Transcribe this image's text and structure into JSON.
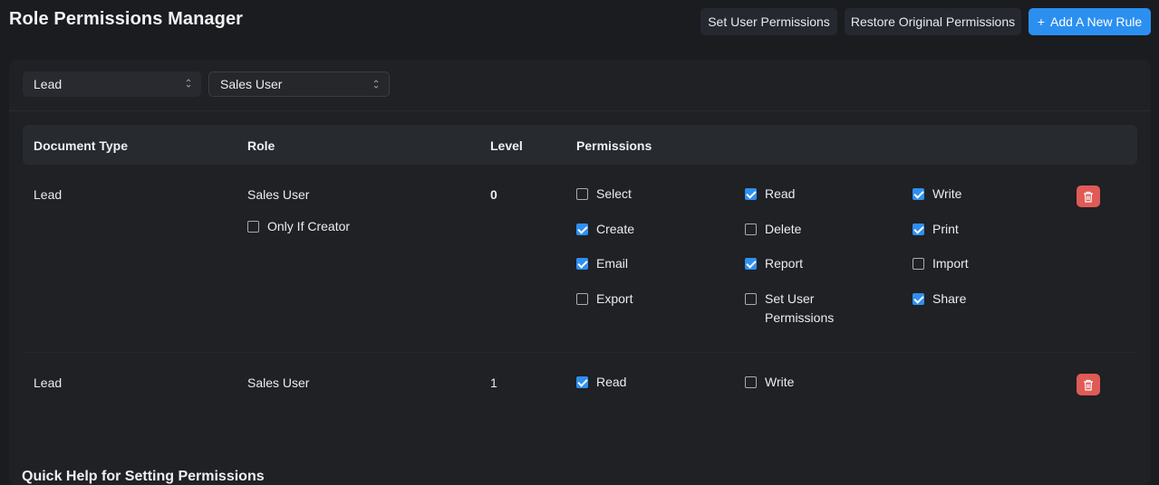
{
  "header": {
    "title": "Role Permissions Manager",
    "set_user_permissions": "Set User Permissions",
    "restore_original": "Restore Original Permissions",
    "add_rule": "Add A New Rule",
    "add_rule_icon": "plus-icon"
  },
  "filters": {
    "doctype": "Lead",
    "role": "Sales User"
  },
  "table": {
    "headers": [
      "Document Type",
      "Role",
      "Level",
      "Permissions"
    ],
    "rows": [
      {
        "doctype": "Lead",
        "role": "Sales User",
        "only_if_creator_label": "Only If Creator",
        "only_if_creator": false,
        "level": "0",
        "permissions": [
          {
            "label": "Select",
            "checked": false
          },
          {
            "label": "Read",
            "checked": true
          },
          {
            "label": "Write",
            "checked": true
          },
          {
            "label": "Create",
            "checked": true
          },
          {
            "label": "Delete",
            "checked": false
          },
          {
            "label": "Print",
            "checked": true
          },
          {
            "label": "Email",
            "checked": true
          },
          {
            "label": "Report",
            "checked": true
          },
          {
            "label": "Import",
            "checked": false
          },
          {
            "label": "Export",
            "checked": false
          },
          {
            "label": "Set User Permissions",
            "checked": false
          },
          {
            "label": "Share",
            "checked": true
          }
        ]
      },
      {
        "doctype": "Lead",
        "role": "Sales User",
        "level": "1",
        "permissions": [
          {
            "label": "Read",
            "checked": true
          },
          {
            "label": "Write",
            "checked": false
          }
        ]
      }
    ]
  },
  "help": {
    "title": "Quick Help for Setting Permissions"
  },
  "colors": {
    "background": "#1b1c1f",
    "accent": "#2b8ff0",
    "danger": "#e05a56"
  }
}
